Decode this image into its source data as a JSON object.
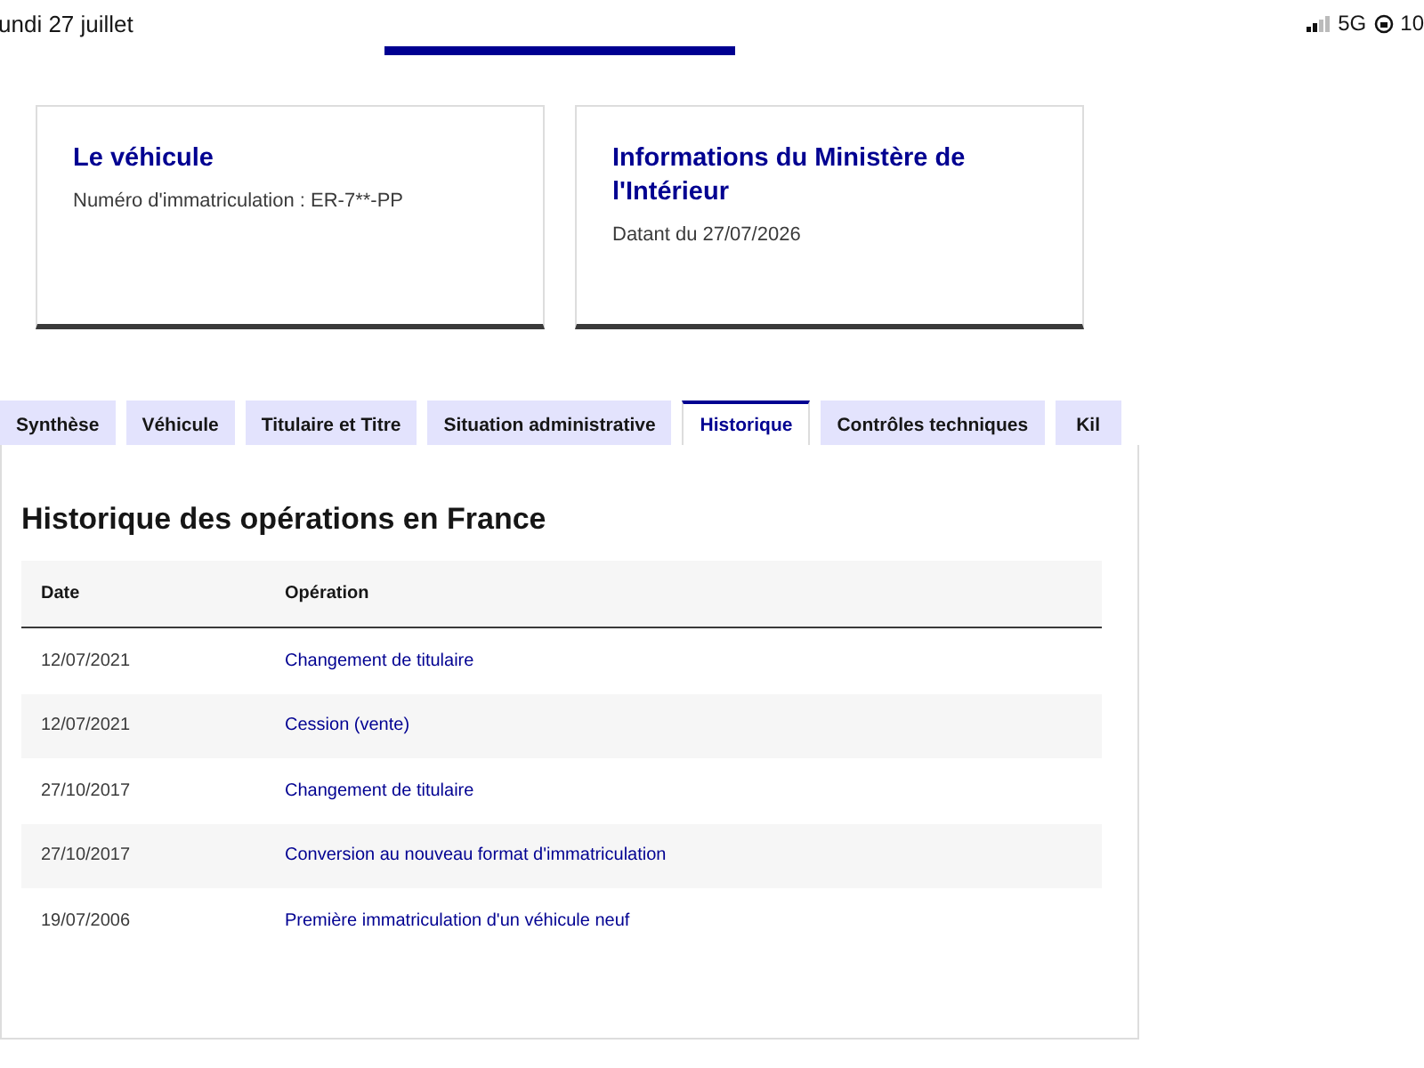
{
  "status_bar": {
    "date": "undi 27 juillet",
    "network": "5G",
    "battery": "10"
  },
  "cards": [
    {
      "title": "Le véhicule",
      "detail": "Numéro d'immatriculation : ER-7**-PP"
    },
    {
      "title": "Informations du Ministère de l'Intérieur",
      "detail": "Datant du 27/07/2026"
    }
  ],
  "tabs": [
    {
      "label": "Synthèse",
      "selected": false
    },
    {
      "label": "Véhicule",
      "selected": false
    },
    {
      "label": "Titulaire et Titre",
      "selected": false
    },
    {
      "label": "Situation administrative",
      "selected": false
    },
    {
      "label": "Historique",
      "selected": true
    },
    {
      "label": "Contrôles techniques",
      "selected": false
    },
    {
      "label": "Kil",
      "selected": false
    }
  ],
  "section_title": "Historique des opérations en France",
  "table": {
    "columns": [
      "Date",
      "Opération"
    ],
    "rows": [
      {
        "date": "12/07/2021",
        "operation": "Changement de titulaire"
      },
      {
        "date": "12/07/2021",
        "operation": "Cession (vente)"
      },
      {
        "date": "27/10/2017",
        "operation": "Changement de titulaire"
      },
      {
        "date": "27/10/2017",
        "operation": "Conversion au nouveau format d'immatriculation"
      },
      {
        "date": "19/07/2006",
        "operation": "Première immatriculation d'un véhicule neuf"
      }
    ]
  }
}
